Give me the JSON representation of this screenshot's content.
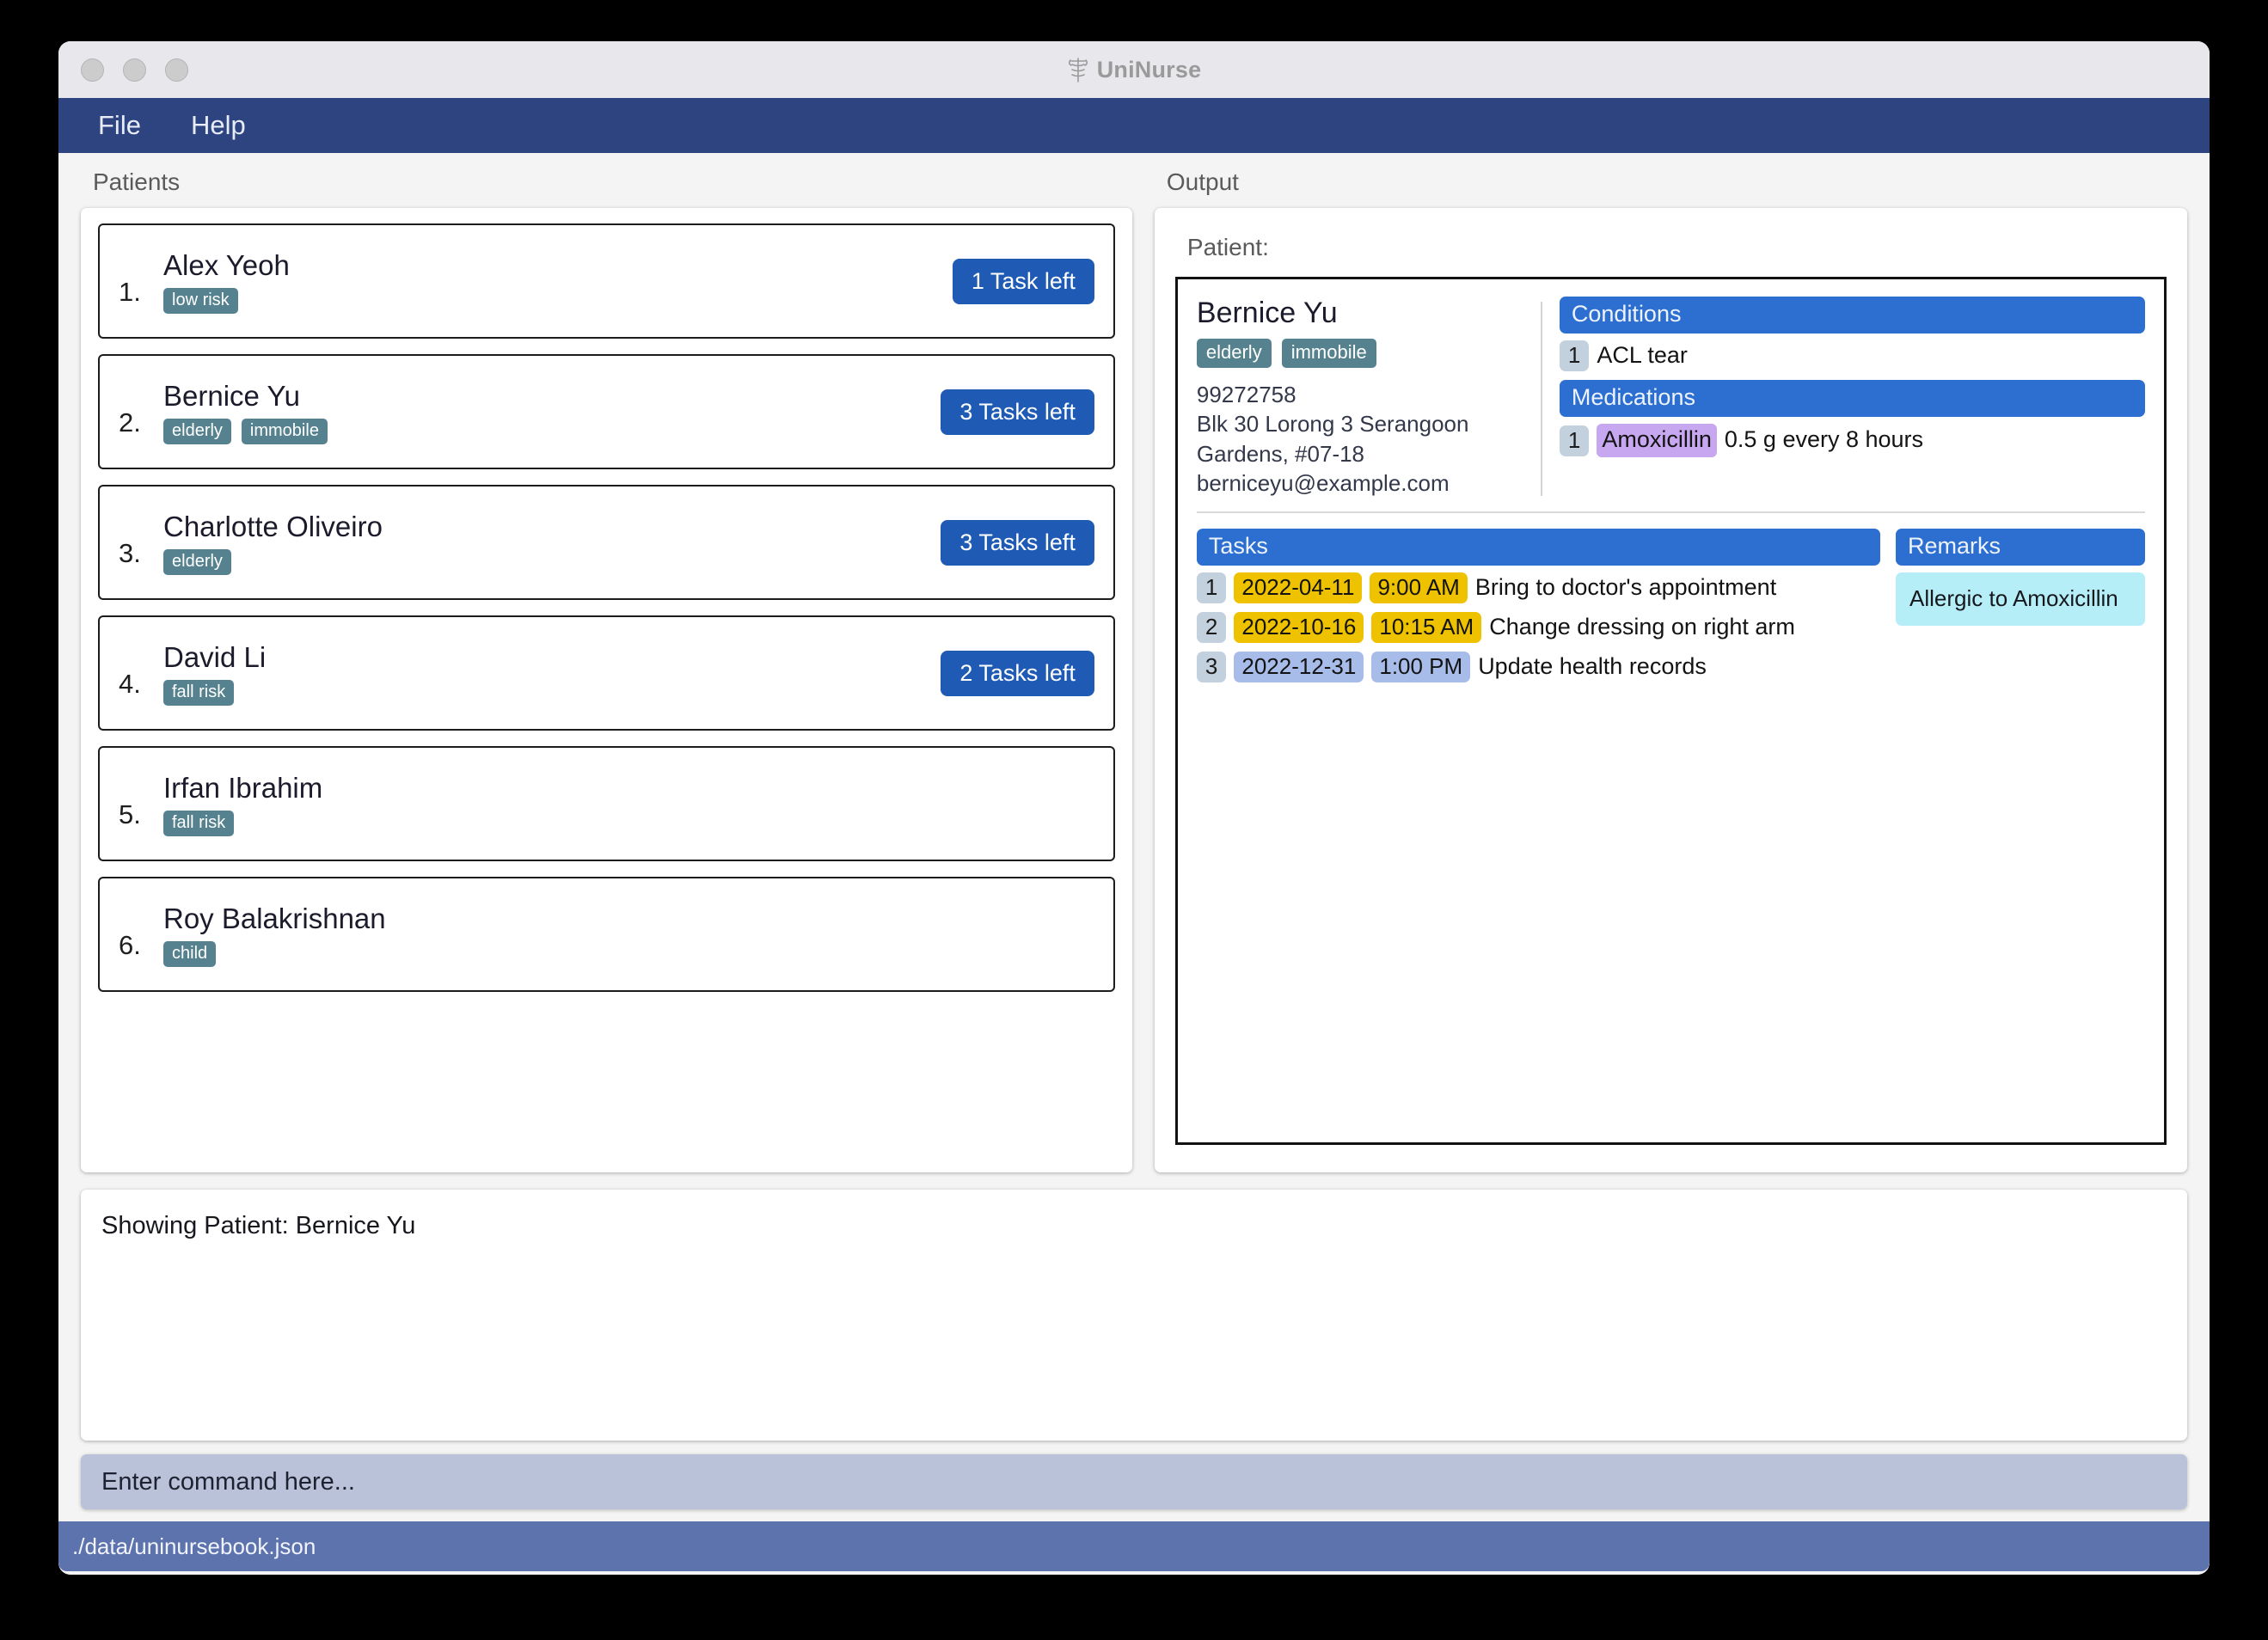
{
  "window": {
    "title": "UniNurse",
    "title_icon": "caduceus-icon",
    "traffic_lights": [
      "close",
      "minimize",
      "maximize"
    ]
  },
  "menu": {
    "items": [
      {
        "label": "File"
      },
      {
        "label": "Help"
      }
    ]
  },
  "left_pane": {
    "label": "Patients",
    "patients": [
      {
        "index": "1.",
        "name": "Alex Yeoh",
        "tags": [
          "low risk"
        ],
        "tasks_badge": "1 Task left"
      },
      {
        "index": "2.",
        "name": "Bernice Yu",
        "tags": [
          "elderly",
          "immobile"
        ],
        "tasks_badge": "3 Tasks left"
      },
      {
        "index": "3.",
        "name": "Charlotte Oliveiro",
        "tags": [
          "elderly"
        ],
        "tasks_badge": "3 Tasks left"
      },
      {
        "index": "4.",
        "name": "David Li",
        "tags": [
          "fall risk"
        ],
        "tasks_badge": "2 Tasks left"
      },
      {
        "index": "5.",
        "name": "Irfan Ibrahim",
        "tags": [
          "fall risk"
        ],
        "tasks_badge": ""
      },
      {
        "index": "6.",
        "name": "Roy Balakrishnan",
        "tags": [
          "child"
        ],
        "tasks_badge": ""
      }
    ]
  },
  "right_pane": {
    "label": "Output",
    "patient_label": "Patient:",
    "detail": {
      "name": "Bernice Yu",
      "tags": [
        "elderly",
        "immobile"
      ],
      "phone": "99272758",
      "address_line1": "Blk 30 Lorong 3 Serangoon",
      "address_line2": "Gardens, #07-18",
      "email": "berniceyu@example.com",
      "conditions_header": "Conditions",
      "conditions": [
        {
          "index": "1",
          "text": "ACL tear"
        }
      ],
      "medications_header": "Medications",
      "medications": [
        {
          "index": "1",
          "name": "Amoxicillin",
          "dosage": "0.5 g every 8 hours"
        }
      ],
      "tasks_header": "Tasks",
      "tasks": [
        {
          "index": "1",
          "date": "2022-04-11",
          "time": "9:00 AM",
          "description": "Bring to doctor's appointment",
          "highlight": "gold"
        },
        {
          "index": "2",
          "date": "2022-10-16",
          "time": "10:15 AM",
          "description": "Change dressing on right arm",
          "highlight": "gold"
        },
        {
          "index": "3",
          "date": "2022-12-31",
          "time": "1:00 PM",
          "description": "Update health records",
          "highlight": "peri"
        }
      ],
      "remarks_header": "Remarks",
      "remarks": [
        {
          "text": "Allergic to Amoxicillin"
        }
      ]
    }
  },
  "result": {
    "text": "Showing Patient: Bernice Yu"
  },
  "command": {
    "placeholder": "Enter command here...",
    "value": ""
  },
  "status": {
    "file_path": "./data/uninursebook.json"
  },
  "colors": {
    "menu_bar": "#2d4480",
    "status_bar": "#5d73ad",
    "section_header": "#2c6fd1",
    "task_badge": "#1f5bb5",
    "tag": "#56828f",
    "index_badge": "#c3d0dd",
    "medication_highlight": "#c7a7f0",
    "datetime_gold": "#efc200",
    "datetime_periwinkle": "#a8bcea",
    "remark_box": "#b5eef7",
    "command_box": "#b9c2d9"
  }
}
